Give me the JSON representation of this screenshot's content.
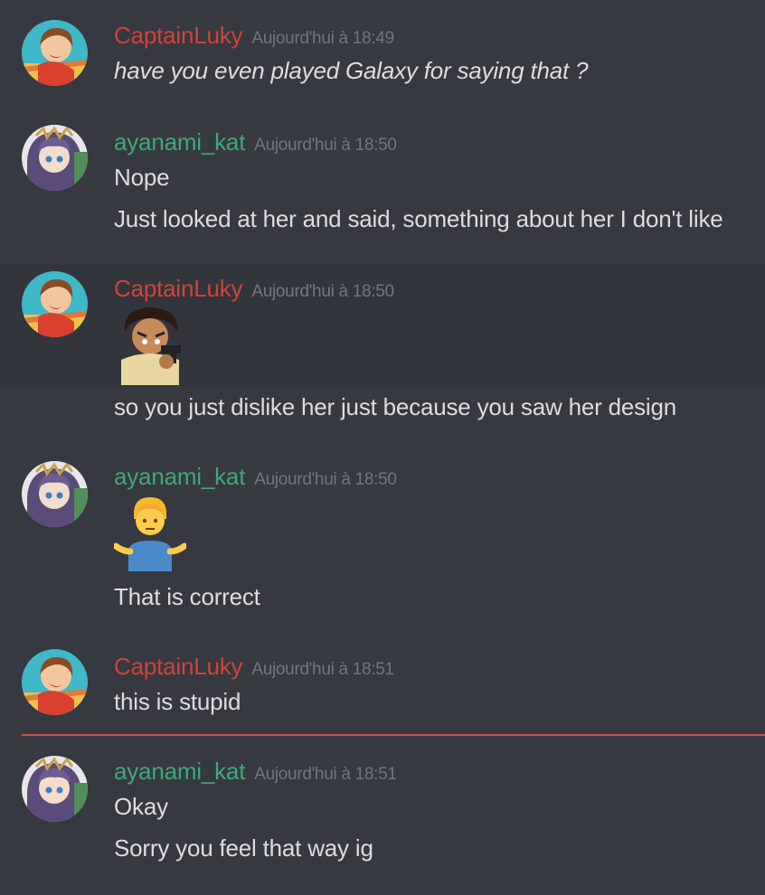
{
  "colors": {
    "background": "#36393f",
    "captain": "#d0433a",
    "ayanami": "#3fa87e",
    "timestamp": "#72767d",
    "text": "#dcddde",
    "new_divider": "#d34f4f"
  },
  "messages": [
    {
      "author": "CaptainLuky",
      "time": "Aujourd'hui à 18:49",
      "lines": [
        "have you even played Galaxy for saying that ?"
      ]
    },
    {
      "author": "ayanami_kat",
      "time": "Aujourd'hui à 18:50",
      "lines": [
        "Nope",
        "Just looked at her and said, something about her I don't like"
      ]
    },
    {
      "author": "CaptainLuky",
      "time": "Aujourd'hui à 18:50",
      "sticker": "anime-gun-emote",
      "lines": [
        "so you just dislike her just because you saw her design"
      ]
    },
    {
      "author": "ayanami_kat",
      "time": "Aujourd'hui à 18:50",
      "emoji": "person-shrugging",
      "lines": [
        "That is correct"
      ]
    },
    {
      "author": "CaptainLuky",
      "time": "Aujourd'hui à 18:51",
      "lines": [
        "this is stupid"
      ]
    },
    {
      "author": "ayanami_kat",
      "time": "Aujourd'hui à 18:51",
      "lines": [
        "Okay",
        "Sorry you feel that way ig"
      ]
    }
  ]
}
